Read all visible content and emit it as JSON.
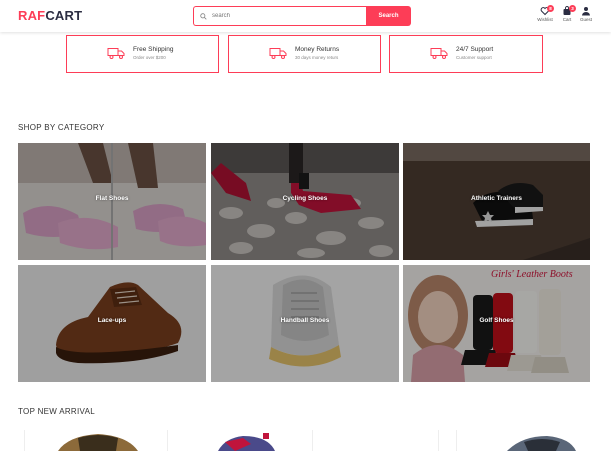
{
  "header": {
    "logo_part1": "RAF",
    "logo_part2": "CART",
    "search": {
      "placeholder": "search",
      "button_label": "Search"
    },
    "wishlist": {
      "label": "Wishlist",
      "count": "8"
    },
    "cart": {
      "label": "Cart",
      "count": "3"
    },
    "account": {
      "label": "Guest"
    }
  },
  "features": [
    {
      "title": "Free Shipping",
      "subtitle": "Order over $200",
      "icon": "truck-icon"
    },
    {
      "title": "Money Returns",
      "subtitle": "30 days money returs",
      "icon": "truck-icon"
    },
    {
      "title": "24/7 Support",
      "subtitle": "Customer support",
      "icon": "truck-icon"
    }
  ],
  "categories_section": {
    "title": "SHOP BY CATEGORY",
    "items": [
      {
        "name": "Flat Shoes"
      },
      {
        "name": "Cycling Shoes"
      },
      {
        "name": "Athletic Trainers"
      },
      {
        "name": "Lace-ups"
      },
      {
        "name": "Handball Shoes"
      },
      {
        "name": "Golf Shoes",
        "image_caption": "Girls' Leather Boots"
      }
    ]
  },
  "arrivals_section": {
    "title": "TOP NEW ARRIVAL"
  },
  "colors": {
    "accent": "#fd3d57",
    "dark": "#2b2d42"
  }
}
